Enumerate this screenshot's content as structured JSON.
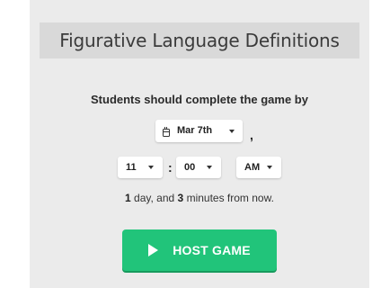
{
  "title": "Figurative Language Definitions",
  "prompt": "Students should complete the game by",
  "date": {
    "selected": "Mar 7th",
    "icon": "calendar-icon"
  },
  "date_separator": ",",
  "time": {
    "hour": "11",
    "minute": "00",
    "time_separator": ":",
    "period": "AM"
  },
  "relative": {
    "days_count": "1",
    "days_text": " day, and ",
    "minutes_count": "3",
    "minutes_text": " minutes from now."
  },
  "host_button": {
    "label": "HOST GAME",
    "icon": "play-icon",
    "color": "#21c47a"
  }
}
